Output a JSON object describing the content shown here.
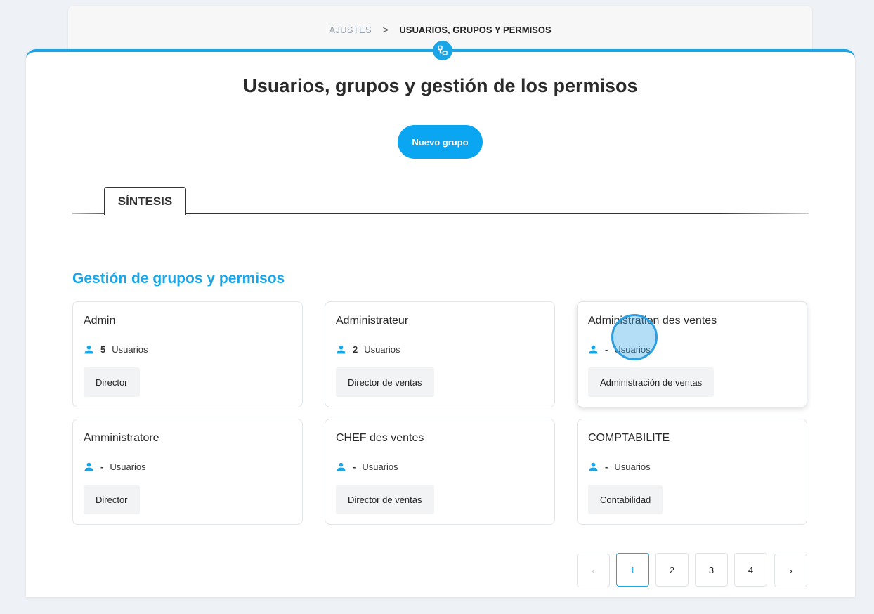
{
  "breadcrumb": {
    "parent": "AJUSTES",
    "separator": ">",
    "current": "USUARIOS, GRUPOS Y PERMISOS"
  },
  "header": {
    "icon": "group-settings-icon",
    "title": "Usuarios, grupos y gestión de los permisos",
    "new_group_label": "Nuevo grupo"
  },
  "tabs": [
    {
      "label": "SÍNTESIS",
      "active": true
    }
  ],
  "section": {
    "title": "Gestión de grupos y permisos"
  },
  "groups": [
    {
      "name": "Admin",
      "count": "5",
      "users_label": "Usuarios",
      "role": "Director"
    },
    {
      "name": "Administrateur",
      "count": "2",
      "users_label": "Usuarios",
      "role": "Director de ventas"
    },
    {
      "name": "Administration des ventes",
      "count": "-",
      "users_label": "Usuarios",
      "role": "Administración de ventas"
    },
    {
      "name": "Amministratore",
      "count": "-",
      "users_label": "Usuarios",
      "role": "Director"
    },
    {
      "name": "CHEF des ventes",
      "count": "-",
      "users_label": "Usuarios",
      "role": "Director de ventas"
    },
    {
      "name": "COMPTABILITE",
      "count": "-",
      "users_label": "Usuarios",
      "role": "Contabilidad"
    }
  ],
  "pagination": {
    "prev": "‹",
    "pages": [
      "1",
      "2",
      "3",
      "4"
    ],
    "current_page": "1",
    "next": "›"
  },
  "colors": {
    "accent": "#1aa6e6",
    "button": "#0aa6f2"
  }
}
